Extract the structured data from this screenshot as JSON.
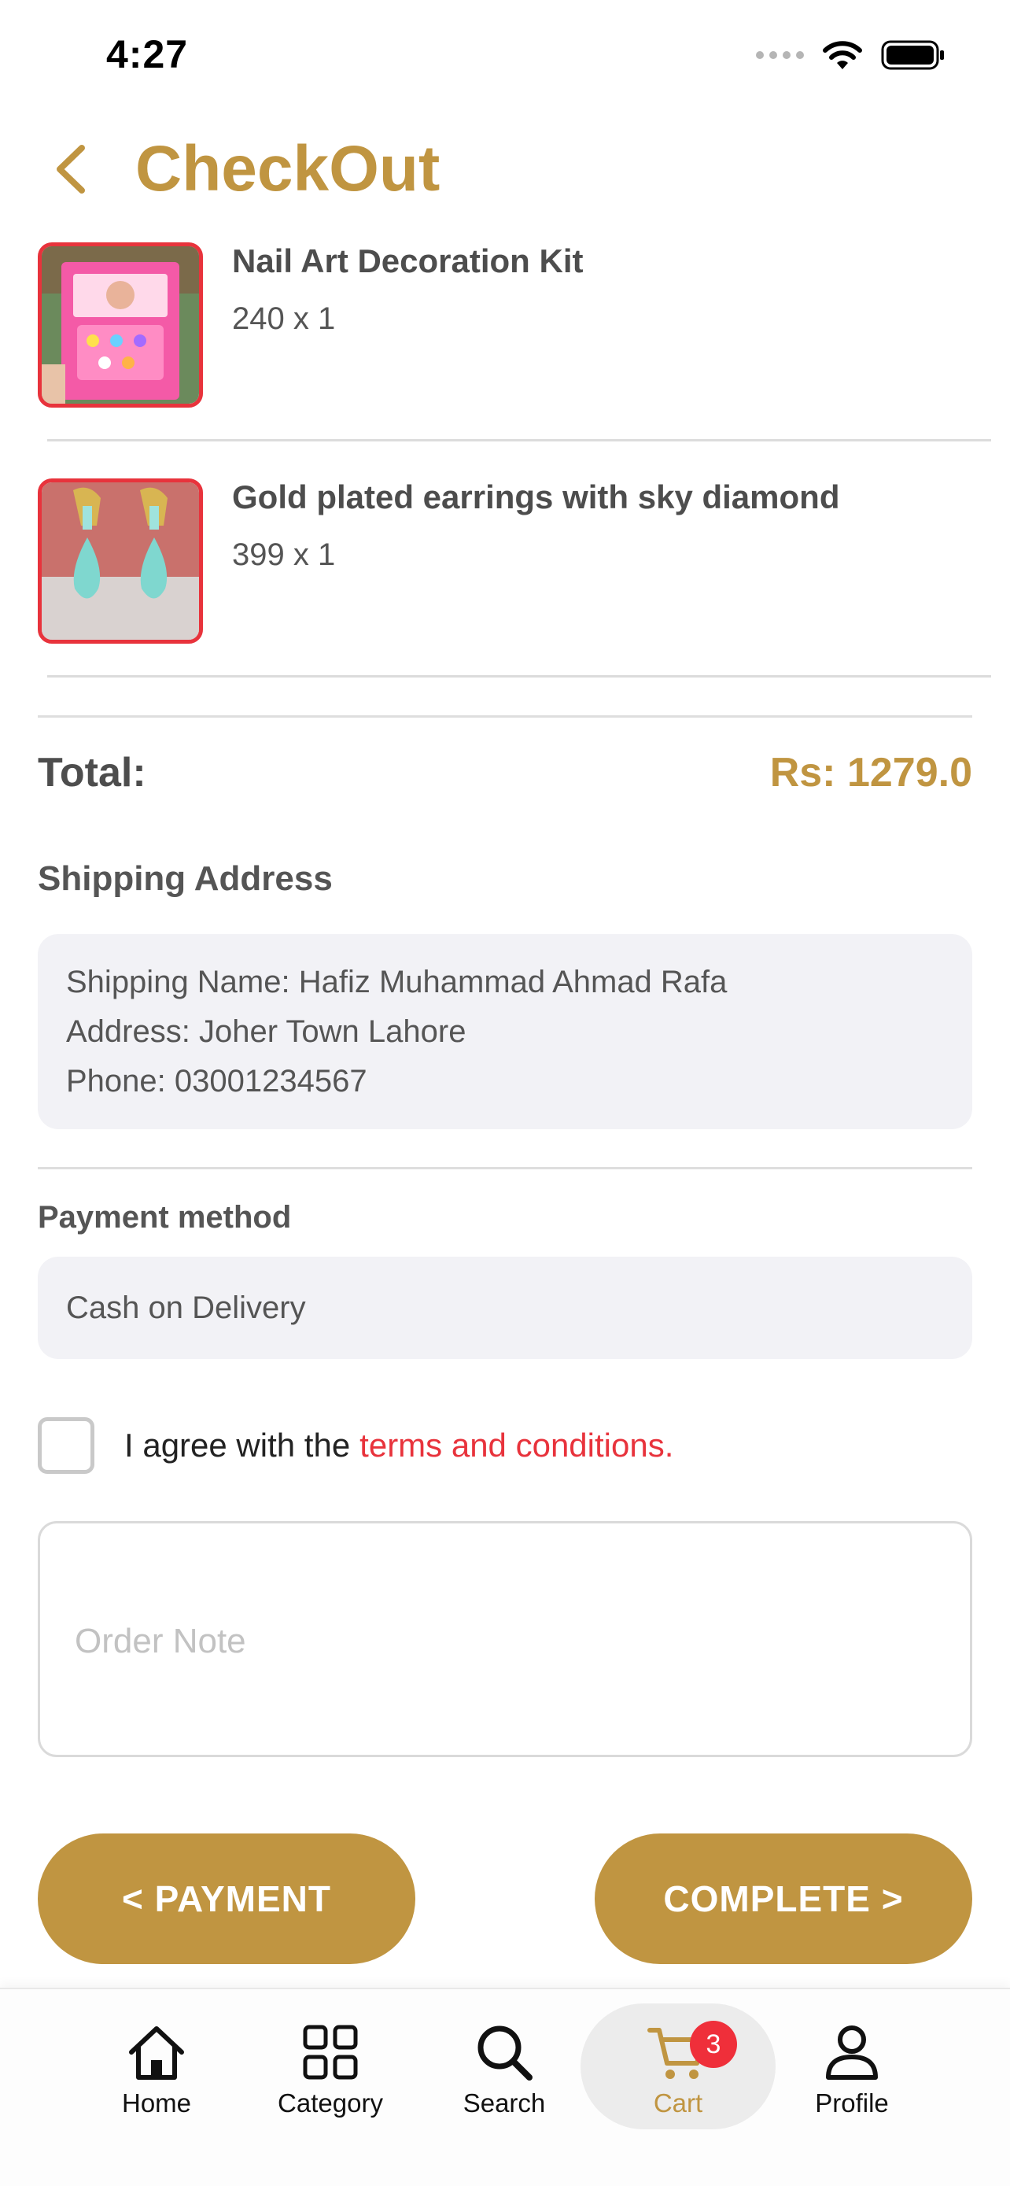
{
  "status_bar": {
    "time": "4:27"
  },
  "header": {
    "title": "CheckOut",
    "back_icon": "chevron-left-icon"
  },
  "items": [
    {
      "name": "Nail Art Decoration Kit",
      "qty_line": "240 x 1"
    },
    {
      "name": "Gold plated earrings with sky diamond",
      "qty_line": "399 x 1"
    }
  ],
  "total": {
    "label": "Total:",
    "value": "Rs: 1279.0"
  },
  "shipping": {
    "heading": "Shipping Address",
    "name_line": "Shipping Name: Hafiz Muhammad Ahmad Rafa",
    "address_line": "Address: Joher Town Lahore",
    "phone_line": "Phone: 03001234567"
  },
  "payment": {
    "heading": "Payment method",
    "value": "Cash on Delivery"
  },
  "agreement": {
    "text": "I agree with the",
    "link": "terms and conditions.",
    "checked": false
  },
  "order_note": {
    "placeholder": "Order Note",
    "value": ""
  },
  "buttons": {
    "payment": "< PAYMENT",
    "complete": "COMPLETE >"
  },
  "tabbar": {
    "active": "cart",
    "home": "Home",
    "category": "Category",
    "search": "Search",
    "cart": "Cart",
    "cart_badge": "3",
    "profile": "Profile"
  },
  "colors": {
    "accent": "#c09541",
    "link": "#e8333c",
    "badge": "#ef2f3a"
  }
}
